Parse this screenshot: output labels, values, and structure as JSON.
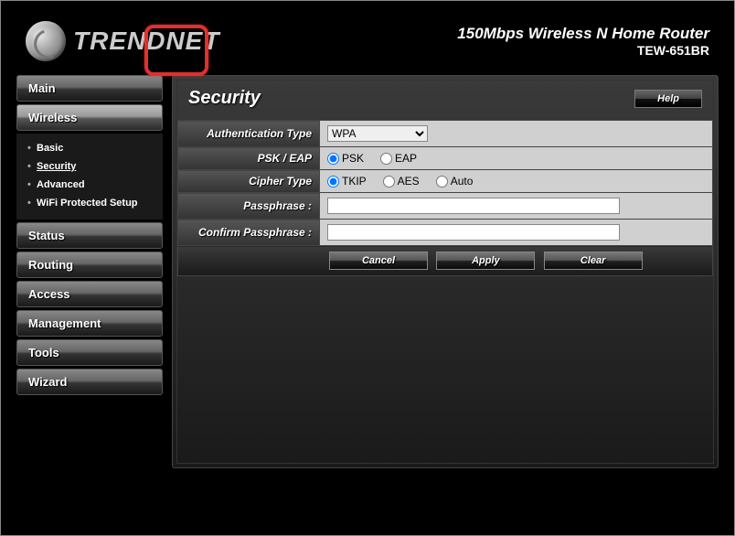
{
  "header": {
    "brand": "TRENDNET",
    "title": "150Mbps Wireless N Home Router",
    "model": "TEW-651BR"
  },
  "nav": {
    "items": [
      "Main",
      "Wireless",
      "Status",
      "Routing",
      "Access",
      "Management",
      "Tools",
      "Wizard"
    ],
    "wireless_sub": [
      "Basic",
      "Security",
      "Advanced",
      "WiFi Protected Setup"
    ]
  },
  "main": {
    "title": "Security",
    "help": "Help"
  },
  "form": {
    "auth_label": "Authentication Type",
    "auth_value": "WPA",
    "psk_eap_label": "PSK / EAP",
    "psk_option": "PSK",
    "eap_option": "EAP",
    "cipher_label": "Cipher Type",
    "tkip_option": "TKIP",
    "aes_option": "AES",
    "auto_option": "Auto",
    "passphrase_label": "Passphrase :",
    "confirm_label": "Confirm Passphrase :",
    "passphrase_value": "",
    "confirm_value": ""
  },
  "buttons": {
    "cancel": "Cancel",
    "apply": "Apply",
    "clear": "Clear"
  }
}
